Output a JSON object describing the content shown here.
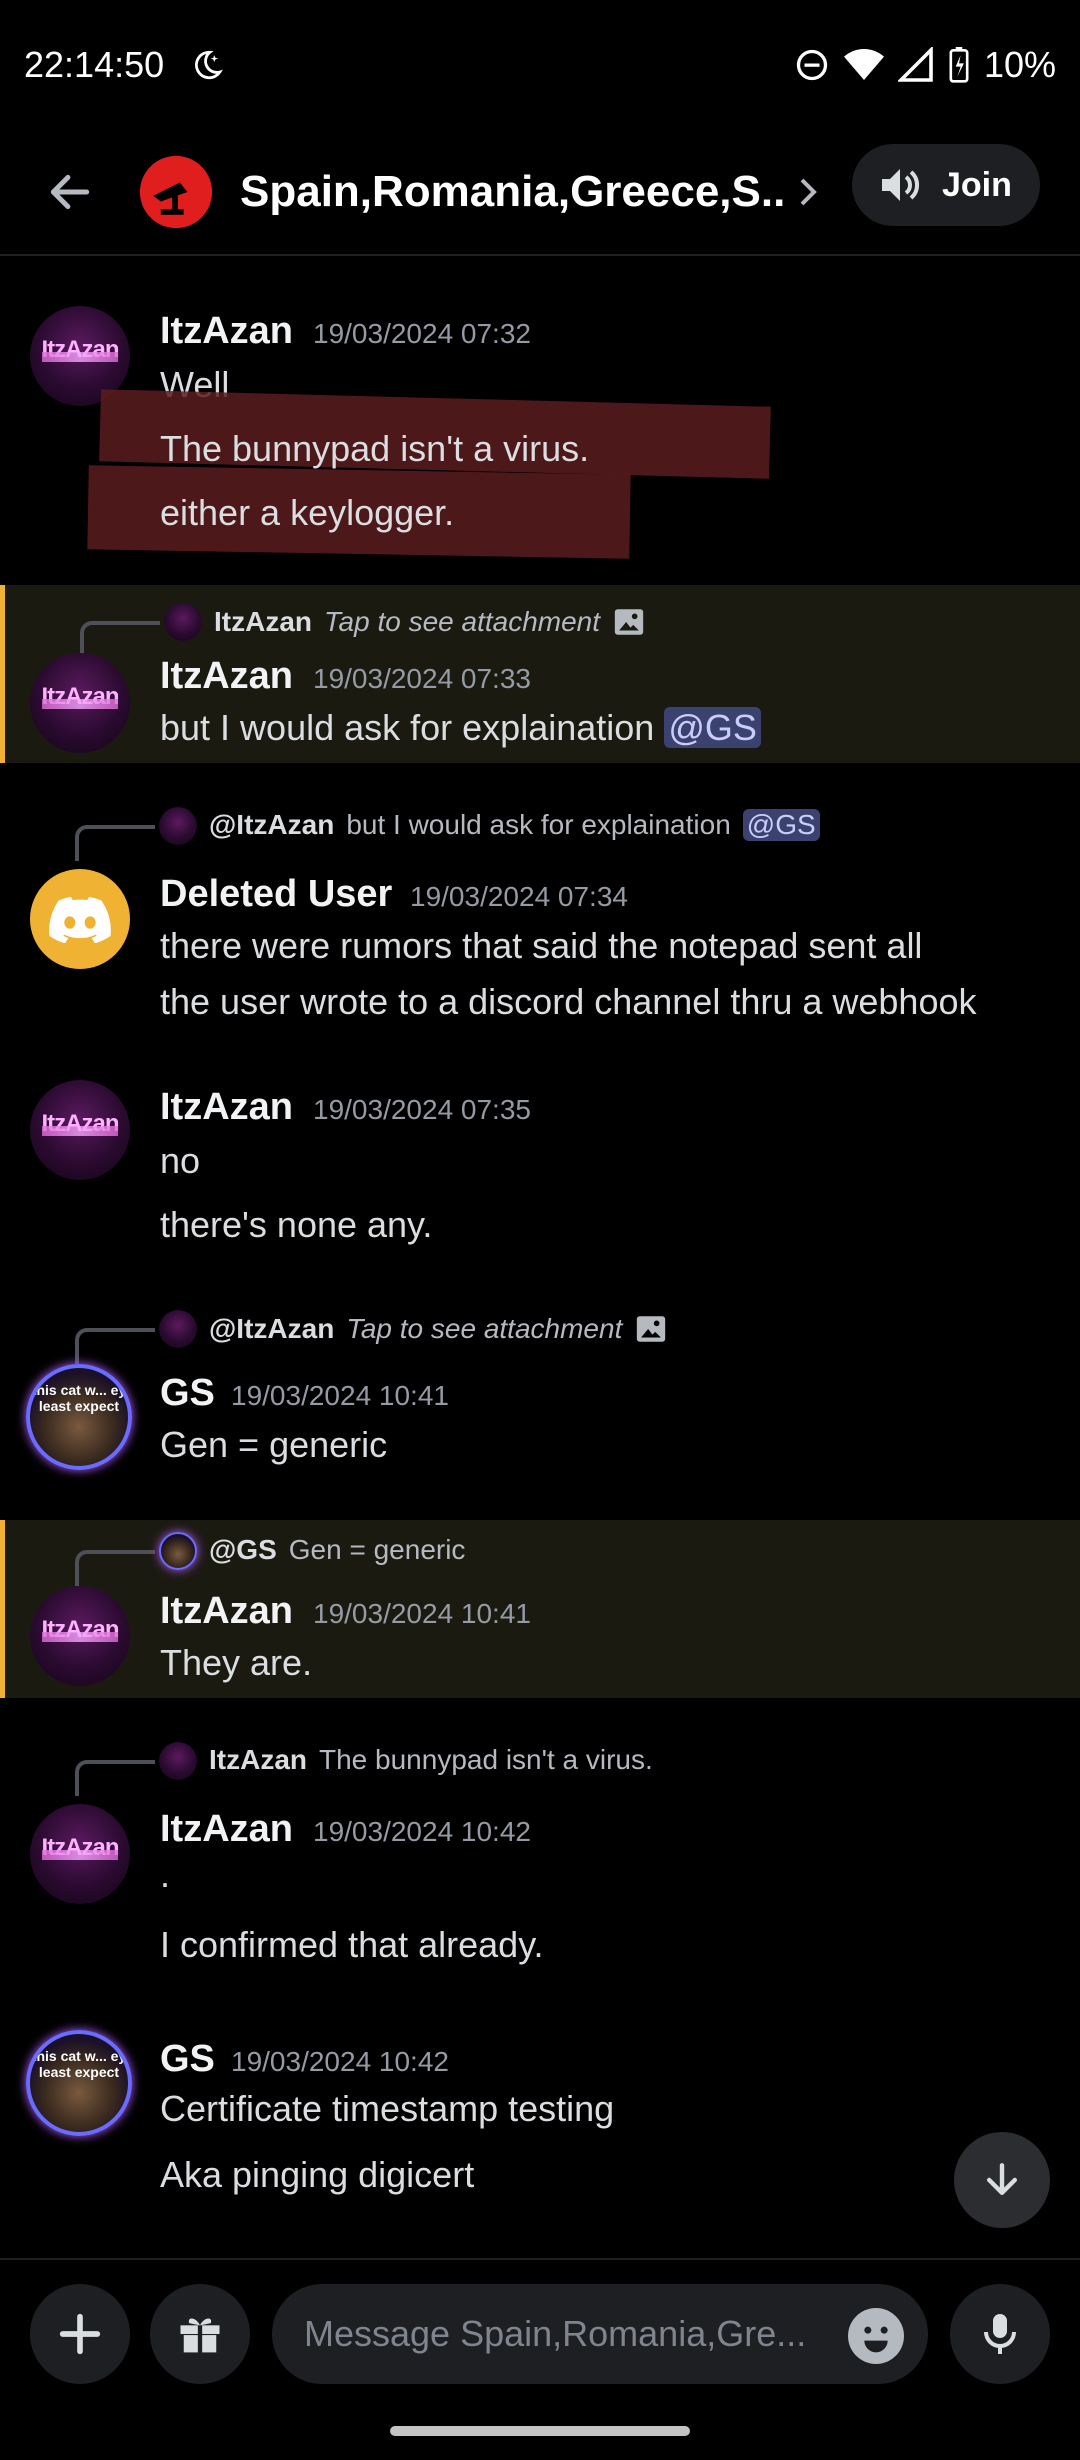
{
  "status_bar": {
    "time": "22:14:50",
    "battery": "10%"
  },
  "header": {
    "channel_name": "Spain,Romania,Greece,S..",
    "join_label": "Join"
  },
  "messages": [
    {
      "author": "ItzAzan",
      "timestamp": "19/03/2024 07:32",
      "lines": [
        "Well",
        "The bunnypad isn't a virus.",
        "either a keylogger."
      ]
    },
    {
      "reply": {
        "name": "ItzAzan",
        "text": "Tap to see attachment"
      },
      "author": "ItzAzan",
      "timestamp": "19/03/2024 07:33",
      "text": "but I would ask for explaination",
      "mention": "@GS"
    },
    {
      "reply": {
        "name": "@ItzAzan",
        "text": "but I would ask for explaination",
        "mention": "@GS"
      },
      "author": "Deleted User",
      "timestamp": "19/03/2024 07:34",
      "lines": [
        "there were rumors that said the notepad sent all",
        "the user wrote to a discord channel thru a webhook"
      ]
    },
    {
      "author": "ItzAzan",
      "timestamp": "19/03/2024 07:35",
      "lines": [
        "no",
        "there's none any."
      ]
    },
    {
      "reply": {
        "name": "@ItzAzan",
        "text": "Tap to see attachment"
      },
      "author": "GS",
      "timestamp": "19/03/2024 10:41",
      "lines": [
        "Gen = generic"
      ]
    },
    {
      "reply": {
        "name": "@GS",
        "text": "Gen = generic"
      },
      "author": "ItzAzan",
      "timestamp": "19/03/2024 10:41",
      "lines": [
        "They are."
      ]
    },
    {
      "reply": {
        "name": "ItzAzan",
        "text": "The bunnypad isn't a virus."
      },
      "author": "ItzAzan",
      "timestamp": "19/03/2024 10:42",
      "lines": [
        ".",
        "I confirmed that already."
      ]
    },
    {
      "author": "GS",
      "timestamp": "19/03/2024 10:42",
      "lines": [
        "Certificate timestamp testing",
        "Aka pinging digicert"
      ]
    }
  ],
  "avatars": {
    "itzazan": "ItzAzan",
    "gs": "this cat w... ey least expect"
  },
  "composer": {
    "placeholder": "Message Spain,Romania,Gre..."
  },
  "colors": {
    "accent": "#f0b232",
    "mention_bg": "#3c4270",
    "background": "#000000"
  }
}
